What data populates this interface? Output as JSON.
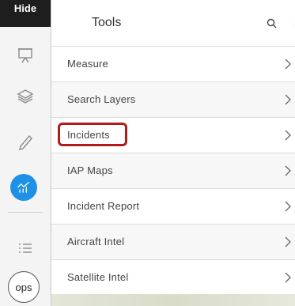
{
  "rail": {
    "hide_label": "Hide",
    "icons": [
      "presentation-icon",
      "layers-icon",
      "pencil-icon",
      "analytics-icon",
      "list-icon"
    ],
    "ops_label": "ops"
  },
  "panel": {
    "title": "Tools",
    "close_label": "×"
  },
  "tools": [
    {
      "label": "Measure"
    },
    {
      "label": "Search Layers"
    },
    {
      "label": "Incidents",
      "highlighted": true
    },
    {
      "label": "IAP Maps"
    },
    {
      "label": "Incident Report"
    },
    {
      "label": "Aircraft Intel"
    },
    {
      "label": "Satellite Intel"
    }
  ],
  "colors": {
    "accent": "#1e90e6",
    "highlight": "#b01c1c",
    "hide_bg": "#1e1e1e"
  }
}
